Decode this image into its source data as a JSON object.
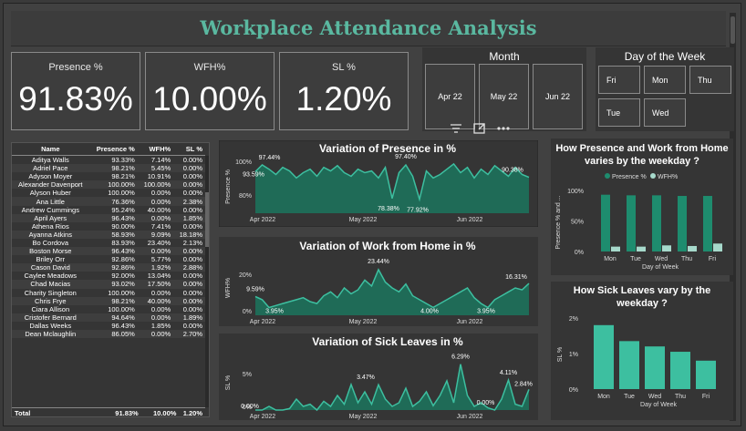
{
  "title": "Workplace Attendance Analysis",
  "kpis": [
    {
      "label": "Presence %",
      "value": "91.83%"
    },
    {
      "label": "WFH%",
      "value": "10.00%"
    },
    {
      "label": "SL %",
      "value": "1.20%"
    }
  ],
  "month_slicer": {
    "title": "Month",
    "options": [
      "Apr 22",
      "May 22",
      "Jun 22"
    ]
  },
  "day_slicer": {
    "title": "Day of the Week",
    "options": [
      "Fri",
      "Mon",
      "Thu",
      "Tue",
      "Wed"
    ]
  },
  "toolbar_icons": [
    "filter-icon",
    "focus-mode-icon",
    "more-options-icon"
  ],
  "table": {
    "columns": [
      "Name",
      "Presence %",
      "WFH%",
      "SL %"
    ],
    "rows": [
      [
        "Aditya Walls",
        "93.33%",
        "7.14%",
        "0.00%"
      ],
      [
        "Adriel Pace",
        "98.21%",
        "5.45%",
        "0.00%"
      ],
      [
        "Adyson Moyer",
        "98.21%",
        "10.91%",
        "0.00%"
      ],
      [
        "Alexander Davenport",
        "100.00%",
        "100.00%",
        "0.00%"
      ],
      [
        "Alyson Huber",
        "100.00%",
        "0.00%",
        "0.00%"
      ],
      [
        "Ana Little",
        "76.36%",
        "0.00%",
        "2.38%"
      ],
      [
        "Andrew Cummings",
        "95.24%",
        "40.00%",
        "0.00%"
      ],
      [
        "April Ayers",
        "96.43%",
        "0.00%",
        "1.85%"
      ],
      [
        "Athena Rios",
        "90.00%",
        "7.41%",
        "0.00%"
      ],
      [
        "Ayanna Atkins",
        "58.93%",
        "9.09%",
        "18.18%"
      ],
      [
        "Bo Cordova",
        "83.93%",
        "23.40%",
        "2.13%"
      ],
      [
        "Boston Morse",
        "96.43%",
        "0.00%",
        "0.00%"
      ],
      [
        "Briley Orr",
        "92.86%",
        "5.77%",
        "0.00%"
      ],
      [
        "Cason David",
        "92.86%",
        "1.92%",
        "2.88%"
      ],
      [
        "Caylee Meadows",
        "92.00%",
        "13.04%",
        "0.00%"
      ],
      [
        "Chad Macias",
        "93.02%",
        "17.50%",
        "0.00%"
      ],
      [
        "Charity Singleton",
        "100.00%",
        "0.00%",
        "0.00%"
      ],
      [
        "Chris Frye",
        "98.21%",
        "40.00%",
        "0.00%"
      ],
      [
        "Ciara Allison",
        "100.00%",
        "0.00%",
        "0.00%"
      ],
      [
        "Cristofer Bernard",
        "94.64%",
        "0.00%",
        "1.89%"
      ],
      [
        "Dallas Weeks",
        "96.43%",
        "1.85%",
        "0.00%"
      ],
      [
        "Dean Mclaughlin",
        "86.05%",
        "0.00%",
        "2.70%"
      ]
    ],
    "total": [
      "Total",
      "91.83%",
      "10.00%",
      "1.20%"
    ]
  },
  "chart_data": [
    {
      "type": "area",
      "title": "Variation of Presence in %",
      "ylabel": "Presence %",
      "yticks": [
        "100%",
        "80%"
      ],
      "xticks": [
        "Apr 2022",
        "May 2022",
        "Jun 2022"
      ],
      "ylim": [
        70,
        100
      ],
      "labels": [
        "97.44%",
        "93.59%",
        "97.40%",
        "78.38%",
        "77.92%",
        "90.38%"
      ],
      "series": [
        {
          "values": [
            93.6,
            97.4,
            95,
            92,
            96,
            94,
            90,
            93,
            95,
            91,
            96,
            94,
            97,
            93,
            91,
            95,
            93,
            94,
            90,
            96,
            78.4,
            93,
            97.4,
            91,
            77.9,
            94,
            90,
            92,
            95,
            98,
            93,
            96,
            90,
            95,
            92,
            97,
            94,
            91,
            96,
            92,
            90.4
          ]
        }
      ]
    },
    {
      "type": "area",
      "title": "Variation of Work from Home in %",
      "ylabel": "WFH%",
      "yticks": [
        "20%",
        "0%"
      ],
      "xticks": [
        "Apr 2022",
        "May 2022",
        "Jun 2022"
      ],
      "ylim": [
        0,
        28
      ],
      "labels": [
        "9.59%",
        "3.95%",
        "23.44%",
        "4.00%",
        "3.95%",
        "16.31%"
      ],
      "series": [
        {
          "values": [
            9.6,
            8,
            3.95,
            5,
            6,
            7,
            8,
            9,
            7,
            6,
            10,
            12,
            9,
            14,
            11,
            13,
            18,
            15,
            23.4,
            17,
            14,
            12,
            16,
            10,
            8,
            6,
            4,
            6,
            8,
            10,
            12,
            14,
            9,
            6,
            3.95,
            8,
            10,
            12,
            14,
            13,
            16.3
          ]
        }
      ]
    },
    {
      "type": "area",
      "title": "Variation of Sick Leaves in %",
      "ylabel": "SL %",
      "yticks": [
        "5%",
        "0%"
      ],
      "xticks": [
        "Apr 2022",
        "May 2022",
        "Jun 2022"
      ],
      "ylim": [
        0,
        7.5
      ],
      "labels": [
        "0.00%",
        "3.47%",
        "6.29%",
        "4.11%",
        "0.00%",
        "2.84%"
      ],
      "series": [
        {
          "values": [
            0,
            0,
            0.5,
            0,
            0,
            0.2,
            1.5,
            0.5,
            0.8,
            0,
            1.2,
            0.5,
            2,
            0.8,
            3.5,
            1,
            2.5,
            0.8,
            3.47,
            1.5,
            0.5,
            1,
            3,
            0.5,
            1.2,
            2.5,
            0.6,
            2,
            4,
            1,
            6.29,
            2,
            0.5,
            1,
            0.3,
            0,
            1.5,
            4.11,
            0.8,
            0.5,
            2.84
          ]
        }
      ]
    },
    {
      "type": "bar",
      "title": "How Presence and Work from Home varies by the weekday ?",
      "xlabel": "Day of Week",
      "ylabel": "Presence % and ...",
      "categories": [
        "Mon",
        "Tue",
        "Wed",
        "Thu",
        "Fri"
      ],
      "yticks": [
        "100%",
        "50%",
        "0%"
      ],
      "ylim": [
        0,
        100
      ],
      "series": [
        {
          "name": "Presence %",
          "values": [
            93,
            92,
            92,
            91,
            91
          ],
          "color": "#1e8c6e"
        },
        {
          "name": "WFH%",
          "values": [
            8,
            8,
            10,
            9,
            13
          ],
          "color": "#a6d9cb"
        }
      ]
    },
    {
      "type": "bar",
      "title": "How Sick Leaves vary by the weekday ?",
      "xlabel": "Day of Week",
      "ylabel": "SL %",
      "categories": [
        "Mon",
        "Tue",
        "Wed",
        "Thu",
        "Fri"
      ],
      "yticks": [
        "2%",
        "1%",
        "0%"
      ],
      "ylim": [
        0,
        2
      ],
      "series": [
        {
          "values": [
            1.8,
            1.35,
            1.2,
            1.05,
            0.8
          ],
          "color": "#3dbfa0"
        }
      ]
    }
  ]
}
